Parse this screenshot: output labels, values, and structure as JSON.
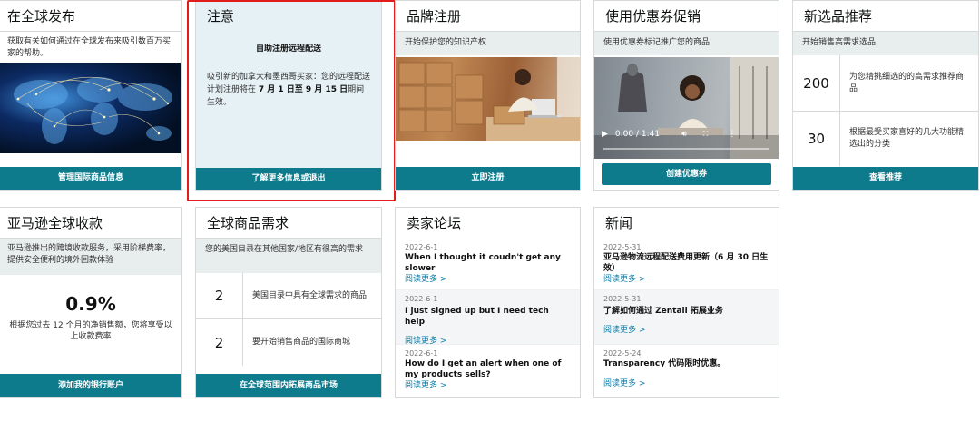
{
  "global_launch": {
    "title": "在全球发布",
    "description": "获取有关如何通过在全球发布来吸引数百万买家的帮助。",
    "button": "管理国际商品信息"
  },
  "notice": {
    "title": "注意",
    "heading": "自助注册远程配送",
    "body_pre": "吸引新的加拿大和墨西哥买家：您的远程配送计划注册将在 ",
    "body_bold": "7 月 1 日至 9 月 15 日",
    "body_post": "期间生效。",
    "button": "了解更多信息或退出"
  },
  "brand": {
    "title": "品牌注册",
    "description": "开始保护您的知识产权",
    "button": "立即注册"
  },
  "coupon": {
    "title": "使用优惠券促销",
    "description": "使用优惠券标记推广您的商品",
    "video_time": "0:00 / 1:41",
    "button": "创建优惠券"
  },
  "new_selection": {
    "title": "新选品推荐",
    "description": "开始销售高需求选品",
    "rows": [
      {
        "num": "200",
        "text": "为您精挑细选的的高需求推荐商品"
      },
      {
        "num": "30",
        "text": "根据最受买家喜好的几大功能精选出的分类"
      }
    ],
    "button": "查看推荐"
  },
  "payments": {
    "title": "亚马逊全球收款",
    "description": "亚马逊推出的跨境收款服务，采用阶梯费率，提供安全便利的境外回款体验",
    "value": "0.9%",
    "value_note": "根据您过去 12 个月的净销售额，您将享受以上收款费率",
    "button": "添加我的银行账户"
  },
  "demand": {
    "title": "全球商品需求",
    "description": "您的美国目录在其他国家/地区有很高的需求",
    "rows": [
      {
        "num": "2",
        "text": "美国目录中具有全球需求的商品"
      },
      {
        "num": "2",
        "text": "要开始销售商品的国际商城"
      }
    ],
    "button": "在全球范围内拓展商品市场"
  },
  "forum": {
    "title": "卖家论坛",
    "items": [
      {
        "date": "2022-6-1",
        "title": "When I thought it coudn't get any slower",
        "more": "阅读更多 >"
      },
      {
        "date": "2022-6-1",
        "title": "I just signed up but I need tech help",
        "more": "阅读更多 >"
      },
      {
        "date": "2022-6-1",
        "title": "How do I get an alert when one of my products sells?",
        "more": "阅读更多 >"
      }
    ]
  },
  "news": {
    "title": "新闻",
    "items": [
      {
        "date": "2022-5-31",
        "title": "亚马逊物流远程配送费用更新（6 月 30 日生效）",
        "more": "阅读更多 >"
      },
      {
        "date": "2022-5-31",
        "title": "了解如何通过 Zentail 拓展业务",
        "more": "阅读更多 >"
      },
      {
        "date": "2022-5-24",
        "title": "Transparency 代码限时优惠。",
        "more": "阅读更多 >"
      }
    ]
  },
  "colors": {
    "button_teal": "#0d7b8c",
    "highlight_red": "#e21b1b",
    "link_blue": "#0a7ca8"
  }
}
